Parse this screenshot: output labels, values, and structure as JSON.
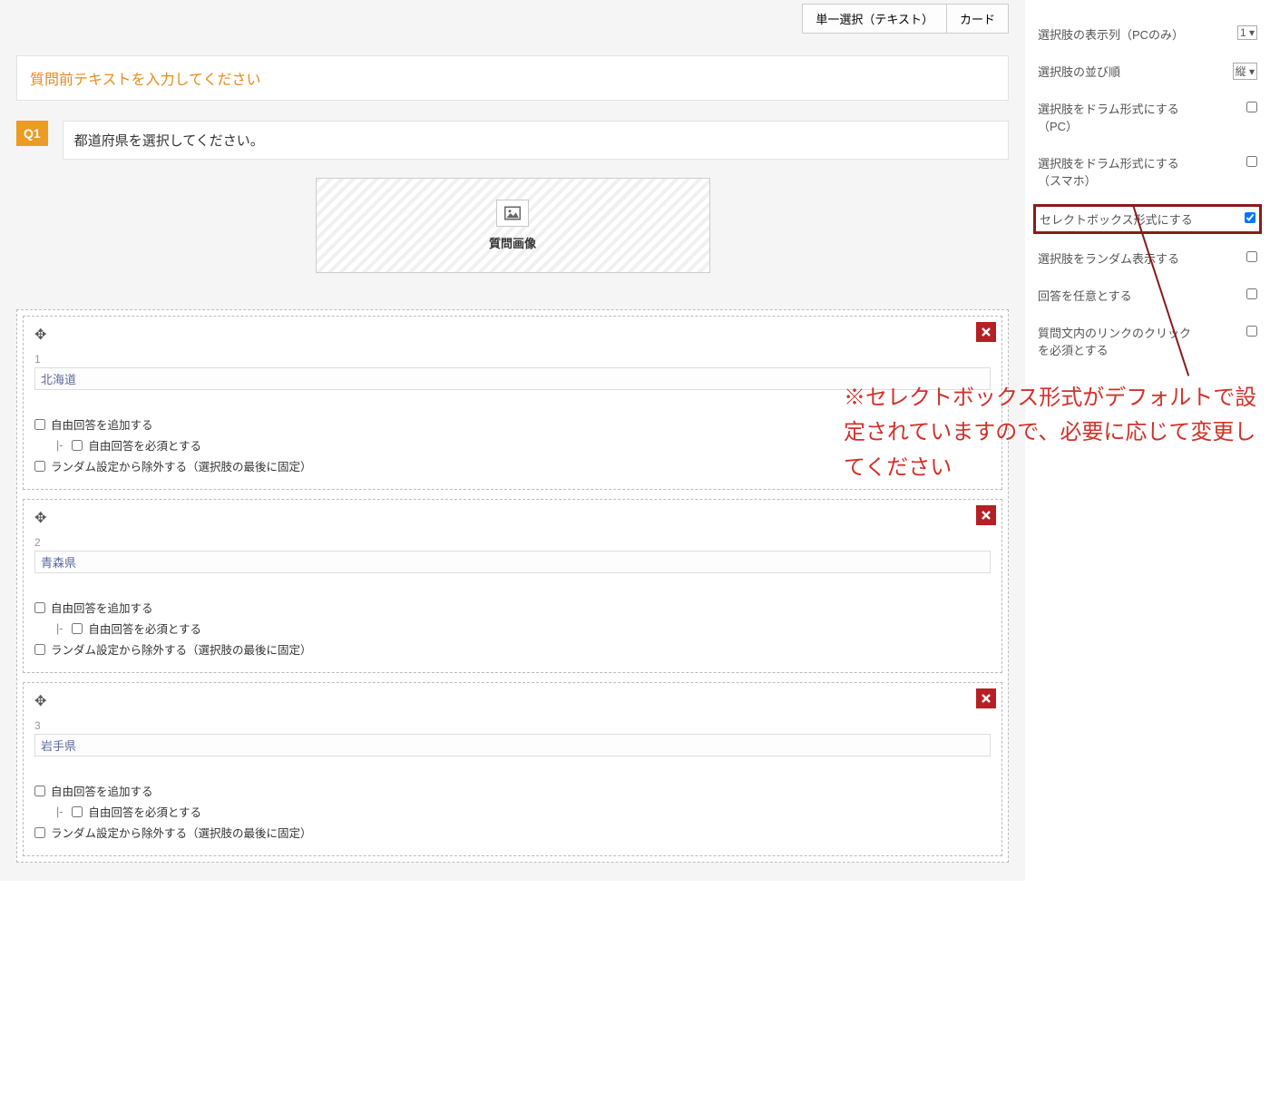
{
  "main": {
    "toolbar": {
      "btn1": "単一選択（テキスト）",
      "btn2": "カード"
    },
    "pretext_placeholder": "質問前テキストを入力してください",
    "qbadge": "Q1",
    "qtext": "都道府県を選択してください。",
    "image_label": "質問画像",
    "options": [
      {
        "index": "1",
        "value": "北海道"
      },
      {
        "index": "2",
        "value": "青森県"
      },
      {
        "index": "3",
        "value": "岩手県"
      }
    ],
    "opt_labels": {
      "free": "自由回答を追加する",
      "free_required": "自由回答を必須とする",
      "exclude_random": "ランダム設定から除外する（選択肢の最後に固定）"
    }
  },
  "sidebar": {
    "rows": [
      {
        "label": "選択肢の表示列（PCのみ）",
        "control": "select",
        "selectValue": "1"
      },
      {
        "label": "選択肢の並び順",
        "control": "select",
        "selectValue": "縦"
      },
      {
        "label": "選択肢をドラム形式にする（PC）",
        "control": "checkbox",
        "checked": false
      },
      {
        "label": "選択肢をドラム形式にする（スマホ）",
        "control": "checkbox",
        "checked": false
      },
      {
        "label": "セレクトボックス形式にする",
        "control": "checkbox",
        "checked": true,
        "highlight": true
      },
      {
        "label": "選択肢をランダム表示する",
        "control": "checkbox",
        "checked": false
      },
      {
        "label": "回答を任意とする",
        "control": "checkbox",
        "checked": false
      },
      {
        "label": "質問文内のリンクのクリックを必須とする",
        "control": "checkbox",
        "checked": false
      }
    ]
  },
  "annotation": "※セレクトボックス形式がデフォルトで設定されていますので、必要に応じて変更してください"
}
